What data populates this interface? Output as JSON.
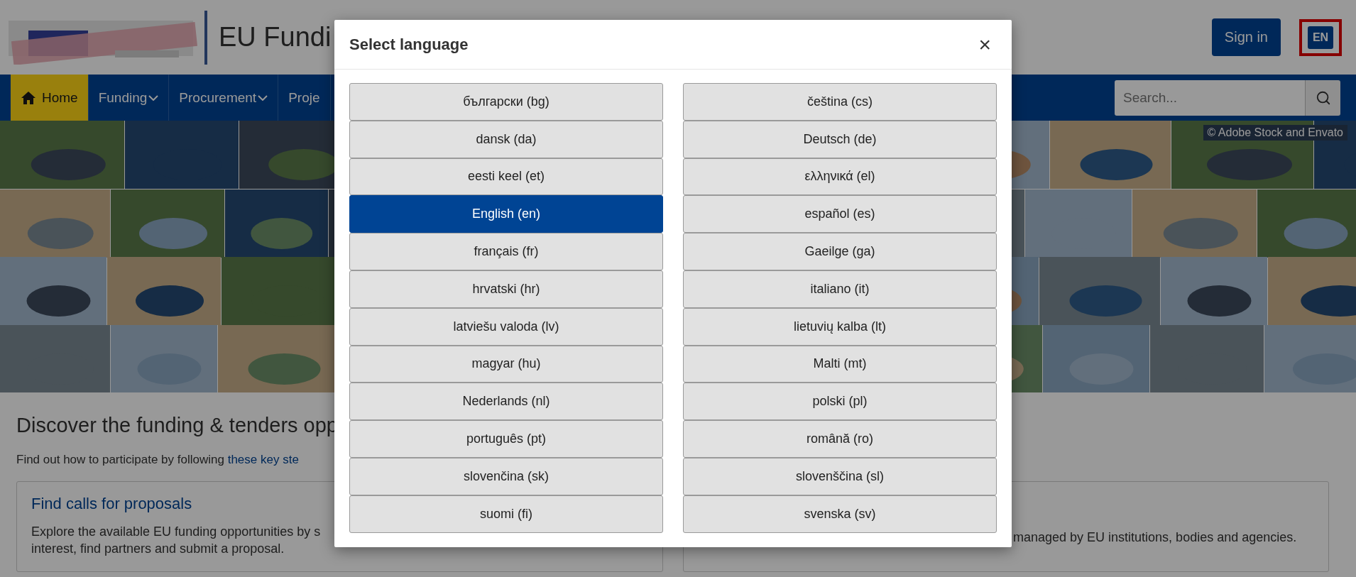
{
  "header": {
    "site_title": "EU Fundi",
    "sign_in": "Sign in",
    "language_button": {
      "label": "EN",
      "highlighted": true
    }
  },
  "nav": {
    "items": [
      {
        "label": "Home",
        "kind": "home",
        "selected": true
      },
      {
        "label": "Funding",
        "kind": "dropdown",
        "selected": false
      },
      {
        "label": "Procurement",
        "kind": "dropdown",
        "selected": false
      },
      {
        "label": "Proje",
        "kind": "plain",
        "selected": false
      }
    ],
    "search": {
      "placeholder": "Search..."
    }
  },
  "banner": {
    "kind": "picture",
    "credit": "© Adobe Stock and Envato"
  },
  "content": {
    "heading": "Discover the funding & tenders opp",
    "intro": "Find out how to participate by following ",
    "intro_link": "these key ste",
    "cards": [
      {
        "title": "Find calls for proposals",
        "text_lines": [
          "Explore the available EU funding opportunities by s",
          "interest, find partners and submit a proposal."
        ]
      },
      {
        "text_lines": [
          "managed by EU institutions, bodies and agencies."
        ]
      }
    ]
  },
  "dialog": {
    "title": "Select language",
    "close": "×",
    "languages": [
      {
        "label": "български (bg)",
        "selected": false
      },
      {
        "label": "čeština (cs)",
        "selected": false
      },
      {
        "label": "dansk (da)",
        "selected": false
      },
      {
        "label": "Deutsch (de)",
        "selected": false
      },
      {
        "label": "eesti keel (et)",
        "selected": false
      },
      {
        "label": "ελληνικά (el)",
        "selected": false
      },
      {
        "label": "English (en)",
        "selected": true
      },
      {
        "label": "español (es)",
        "selected": false
      },
      {
        "label": "français (fr)",
        "selected": false
      },
      {
        "label": "Gaeilge (ga)",
        "selected": false
      },
      {
        "label": "hrvatski (hr)",
        "selected": false
      },
      {
        "label": "italiano (it)",
        "selected": false
      },
      {
        "label": "latviešu valoda (lv)",
        "selected": false
      },
      {
        "label": "lietuvių kalba (lt)",
        "selected": false
      },
      {
        "label": "magyar (hu)",
        "selected": false
      },
      {
        "label": "Malti (mt)",
        "selected": false
      },
      {
        "label": "Nederlands (nl)",
        "selected": false
      },
      {
        "label": "polski (pl)",
        "selected": false
      },
      {
        "label": "português (pt)",
        "selected": false
      },
      {
        "label": "română (ro)",
        "selected": false
      },
      {
        "label": "slovenčina (sk)",
        "selected": false
      },
      {
        "label": "slovenščina (sl)",
        "selected": false
      },
      {
        "label": "suomi (fi)",
        "selected": false
      },
      {
        "label": "svenska (sv)",
        "selected": false
      }
    ]
  }
}
